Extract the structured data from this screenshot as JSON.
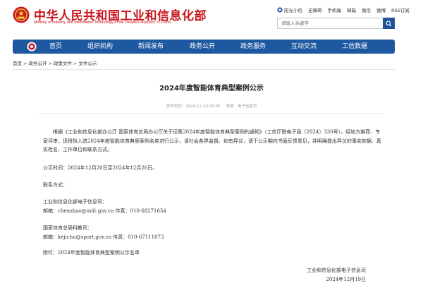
{
  "header": {
    "title_cn": "中华人民共和国工业和信息化部",
    "title_en": "Ministry of Industry and Information Technology of the People's Republic of China",
    "links": [
      "阳光小信",
      "无障碍",
      "手机端",
      "邮箱",
      "微信",
      "微博",
      "RSS订阅"
    ],
    "search_placeholder": "请输入关键字"
  },
  "nav": {
    "items": [
      "首页",
      "组织机构",
      "新闻发布",
      "政务公开",
      "政务服务",
      "互动交流",
      "工信数据"
    ]
  },
  "breadcrumb": [
    "首页",
    "政务公开",
    "政策文件",
    "文件公示"
  ],
  "article": {
    "title": "2024年度智能体育典型案例公示",
    "publish_label": "发布时间：2024-12-20 09:00",
    "source_label": "来源：电子信息司",
    "paragraph": "根据《工业和信息化部办公厅 国家体育总局办公厅关于征集2024年度智能体育典型案例的通知》（工信厅联电子函〔2024〕330号），经地方推荐、专家评审，现将拟入选2024年度智能体育典型案例名单进行公示，请社会各界监督。如有异议，请于公示期内书面反馈意见，并明确提出异议的事实依据、真实姓名、工作单位和联系方式。",
    "period": "公示时间：2024年12月20日至2024年12月26日。",
    "contact_heading": "联系方式：",
    "contact1_org": "工业和信息化部电子信息司：",
    "contact1_detail": "邮箱：chenzhao@miit.gov.cn    传真：010-68271654",
    "contact2_org": "国家体育总局科教司：",
    "contact2_detail": "邮箱：kejichu@sport.gov.cn    传真：010-67111073",
    "attachment": "附件：2024年度智能体育典型案例公示名单",
    "sign_org": "工业和信息化部电子信息司",
    "sign_date": "2024年12月19日"
  },
  "colors": {
    "brand_red": "#c8161d",
    "nav_blue": "#1e58a0",
    "search_btn_blue": "#1f5598"
  }
}
